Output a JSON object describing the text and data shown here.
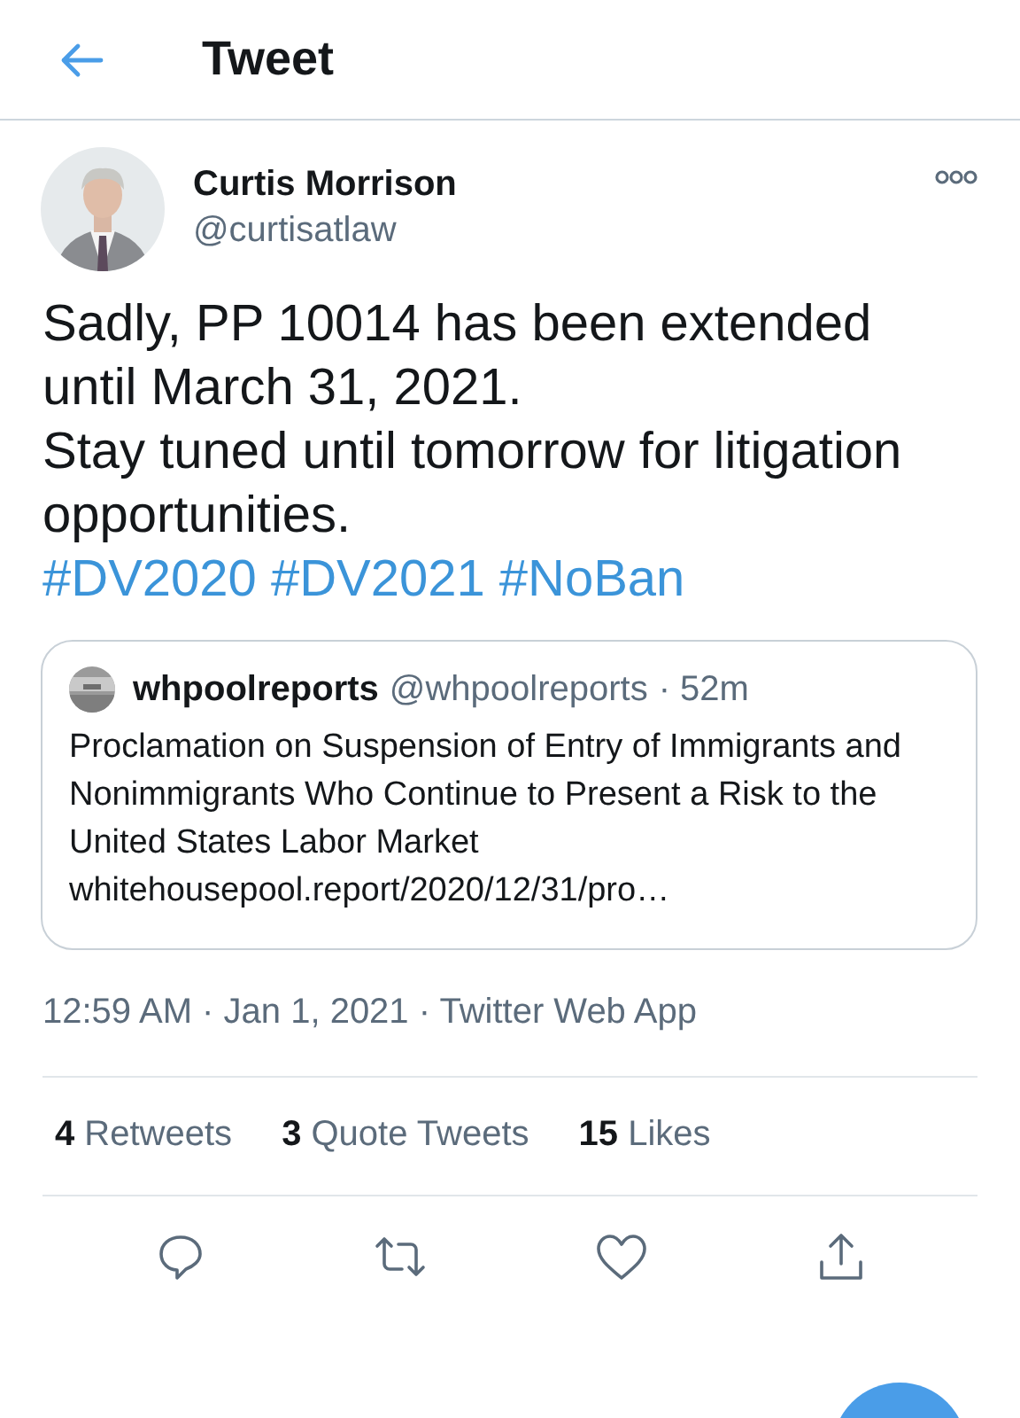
{
  "header": {
    "title": "Tweet"
  },
  "author": {
    "name": "Curtis Morrison",
    "handle": "@curtisatlaw"
  },
  "body": [
    "Sadly, PP 10014 has been extended until March 31, 2021.",
    "Stay tuned until tomorrow for litigation opportunities."
  ],
  "hashtags": [
    "#DV2020",
    "#DV2021",
    "#NoBan"
  ],
  "quote": {
    "name": "whpoolreports",
    "handle": "@whpoolreports",
    "time": "· 52m",
    "text": "Proclamation on Suspension of Entry of Immigrants and Nonimmigrants Who Continue to Present a Risk to the United States Labor Market",
    "link": "whitehousepool.report/2020/12/31/pro…"
  },
  "meta": "12:59 AM · Jan 1, 2021 · Twitter Web App",
  "stats": [
    {
      "count": "4",
      "label": "Retweets"
    },
    {
      "count": "3",
      "label": "Quote Tweets"
    },
    {
      "count": "15",
      "label": "Likes"
    }
  ],
  "actions": [
    {
      "kind": "reply"
    },
    {
      "kind": "retweet"
    },
    {
      "kind": "like"
    },
    {
      "kind": "share"
    }
  ]
}
